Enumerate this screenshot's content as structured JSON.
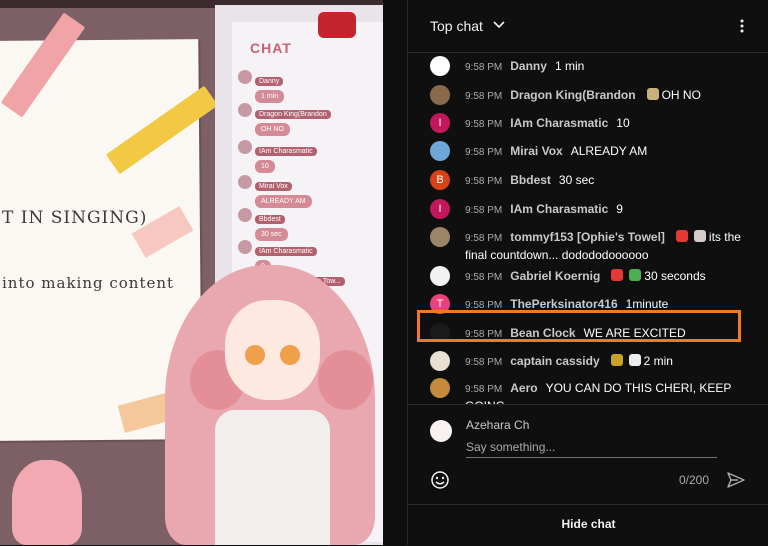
{
  "stream_overlay": {
    "chat_title": "CHAT",
    "paper_line_1": "T IN SINGING)",
    "paper_line_2": "into making content",
    "bubbles": [
      {
        "name": "Danny",
        "text": "1 min"
      },
      {
        "name": "Dragon King(Brandon",
        "text": "OH NO"
      },
      {
        "name": "IAm Charasmatic",
        "text": "10"
      },
      {
        "name": "Mirai Vox",
        "text": "ALREADY AM"
      },
      {
        "name": "Bbdest",
        "text": "30 sec"
      },
      {
        "name": "IAm Charasmatic",
        "text": "9"
      },
      {
        "name": "tommyf153 [Ophie's Tow...",
        "text": ""
      }
    ]
  },
  "chat": {
    "header": {
      "title": "Top chat"
    },
    "messages": [
      {
        "time": "9:58 PM",
        "author": "Danny",
        "text": "1 min",
        "avatar_icon": "logo-avatar",
        "avatar_color": "#ffffff",
        "avatar_letter": ""
      },
      {
        "time": "9:58 PM",
        "author": "Dragon King(Brandon",
        "text": "OH NO",
        "avatar_icon": "photo-avatar",
        "avatar_color": "#8a6a4c",
        "avatar_letter": ""
      },
      {
        "time": "9:58 PM",
        "author": "IAm Charasmatic",
        "text": "10",
        "avatar_icon": "letter-avatar",
        "avatar_color": "#c2185b",
        "avatar_letter": "I"
      },
      {
        "time": "9:58 PM",
        "author": "Mirai Vox",
        "text": "ALREADY AM",
        "avatar_icon": "photo-avatar",
        "avatar_color": "#6fa6d8",
        "avatar_letter": ""
      },
      {
        "time": "9:58 PM",
        "author": "Bbdest",
        "text": "30 sec",
        "avatar_icon": "letter-avatar",
        "avatar_color": "#d84315",
        "avatar_letter": "B"
      },
      {
        "time": "9:58 PM",
        "author": "IAm Charasmatic",
        "text": "9",
        "avatar_icon": "letter-avatar",
        "avatar_color": "#c2185b",
        "avatar_letter": "I"
      },
      {
        "time": "9:58 PM",
        "author": "tommyf153 [Ophie's Towel]",
        "text": "its the final countdown... dodododoooooo",
        "avatar_icon": "photo-avatar",
        "avatar_color": "#9c8468",
        "avatar_letter": ""
      },
      {
        "time": "9:58 PM",
        "author": "Gabriel Koernig",
        "text": "30 seconds",
        "avatar_icon": "photo-avatar",
        "avatar_color": "#f2f2f2",
        "avatar_letter": ""
      },
      {
        "time": "9:58 PM",
        "author": "ThePerksinator416",
        "text": "1minute",
        "avatar_icon": "letter-avatar",
        "avatar_color": "#ec407a",
        "avatar_letter": "T"
      },
      {
        "time": "9:58 PM",
        "author": "Bean Clock",
        "text": "WE ARE EXCITED",
        "avatar_icon": "photo-avatar",
        "avatar_color": "#1a1a1a",
        "avatar_letter": ""
      },
      {
        "time": "9:58 PM",
        "author": "captain cassidy",
        "text": "2 min",
        "avatar_icon": "photo-avatar",
        "avatar_color": "#e8e0d0",
        "avatar_letter": ""
      },
      {
        "time": "9:58 PM",
        "author": "Aero",
        "text": "YOU CAN DO THIS CHERI, KEEP GOING",
        "avatar_icon": "photo-avatar",
        "avatar_color": "#c58b3c",
        "avatar_letter": ""
      }
    ],
    "composer": {
      "username": "Azehara Ch",
      "placeholder": "Say something...",
      "char_count": "0/200"
    },
    "footer": {
      "hide_label": "Hide chat"
    },
    "colors": {
      "accent": "#3ea6ff",
      "highlight": "#ef7a22",
      "background": "#0f0f0f"
    }
  }
}
